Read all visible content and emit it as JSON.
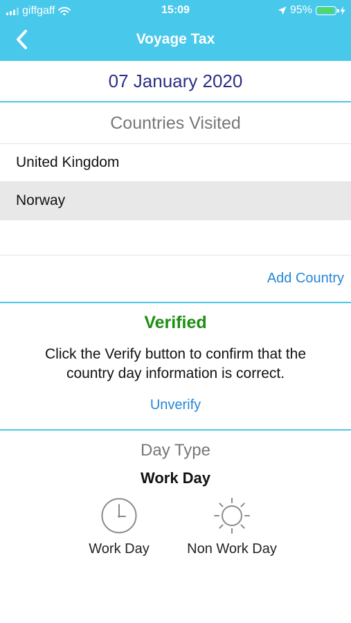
{
  "status_bar": {
    "carrier": "giffgaff",
    "time": "15:09",
    "battery_percent": "95%",
    "battery_level": 0.95,
    "icons": [
      "signal-bars-icon",
      "wifi-icon",
      "location-arrow-icon",
      "battery-icon",
      "charging-bolt-icon"
    ]
  },
  "nav": {
    "title": "Voyage Tax",
    "back_icon": "chevron-left-icon"
  },
  "date": "07 January 2020",
  "countries": {
    "title": "Countries Visited",
    "items": [
      {
        "name": "United Kingdom",
        "selected": false
      },
      {
        "name": "Norway",
        "selected": true
      }
    ],
    "add_label": "Add Country"
  },
  "verification": {
    "status": "Verified",
    "message": "Click the Verify button to confirm that the country day information is correct.",
    "action_label": "Unverify"
  },
  "day_type": {
    "title": "Day Type",
    "current": "Work Day",
    "options": [
      {
        "label": "Work Day",
        "icon": "clock-icon"
      },
      {
        "label": "Non Work Day",
        "icon": "sun-icon"
      }
    ]
  },
  "colors": {
    "header": "#48c8ea",
    "date_text": "#2b2f86",
    "verified": "#1e8e12",
    "link": "#2486d8",
    "selected_row": "#e8e8e8",
    "battery": "#4cd964"
  }
}
